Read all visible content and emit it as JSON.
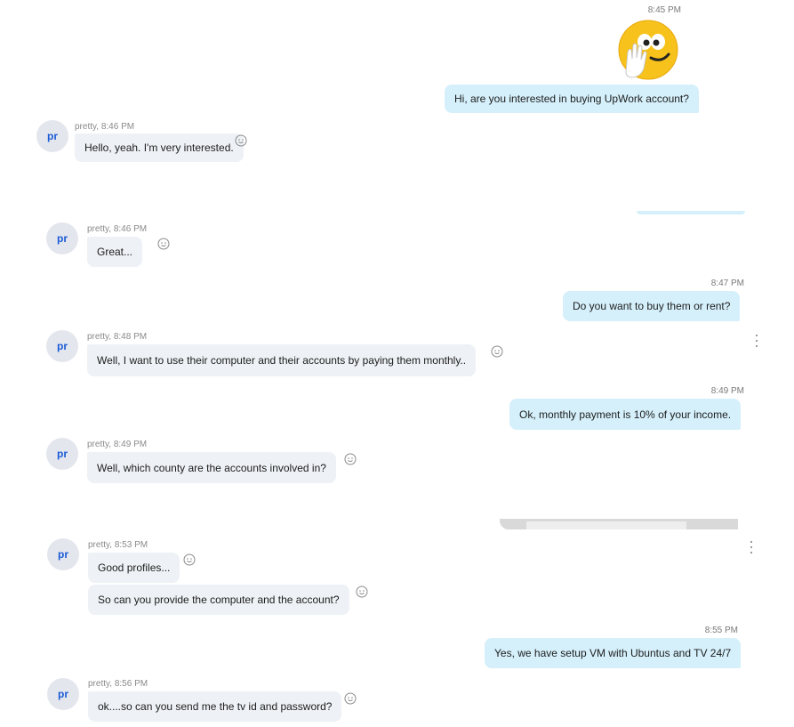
{
  "messages": {
    "m1": {
      "time": "8:45 PM",
      "text": "Hi, are you interested in buying UpWork account?"
    },
    "m2": {
      "meta": "pretty, 8:46 PM",
      "avatar": "pr",
      "text": "Hello, yeah. I'm very interested."
    },
    "m3": {
      "meta": "pretty, 8:46 PM",
      "avatar": "pr",
      "text": "Great..."
    },
    "m4": {
      "time": "8:47 PM",
      "text": "Do you want to buy them or rent?"
    },
    "m5": {
      "meta": "pretty, 8:48 PM",
      "avatar": "pr",
      "text": "Well, I want to use their computer and their accounts by paying them monthly.."
    },
    "m6": {
      "time": "8:49 PM",
      "text": "Ok, monthly payment is 10% of your income."
    },
    "m7": {
      "meta": "pretty, 8:49 PM",
      "avatar": "pr",
      "text": "Well, which county are the accounts involved in?"
    },
    "m8": {
      "meta": "pretty, 8:53 PM",
      "avatar": "pr",
      "text": "Good profiles...",
      "text2": "So can you provide the computer and the account?"
    },
    "m9": {
      "time": "8:55 PM",
      "text": "Yes, we have setup VM with Ubuntus and TV 24/7"
    },
    "m10": {
      "meta": "pretty, 8:56 PM",
      "avatar": "pr",
      "text": "ok....so can you send me the tv id and password?"
    }
  },
  "icons": {
    "reaction": "smiley-icon",
    "menu": "more-options-icon",
    "sticker": "waving-emoji-sticker"
  },
  "colors": {
    "outgoing_bubble": "#d5f0fb",
    "incoming_bubble": "#eef1f5",
    "avatar_bg": "#e4e6ed",
    "avatar_text": "#1a5bd6"
  }
}
